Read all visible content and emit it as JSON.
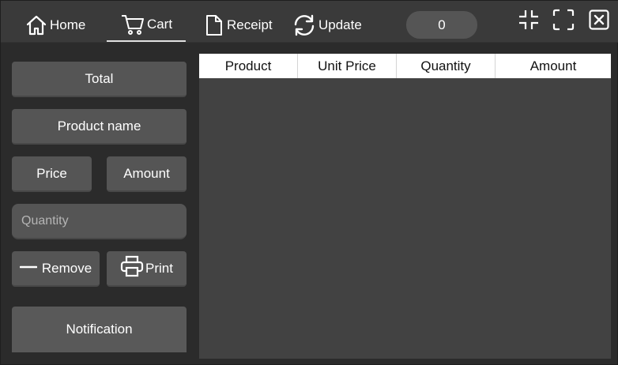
{
  "nav": {
    "home": {
      "label": "Home",
      "icon": "home-icon"
    },
    "cart": {
      "label": "Cart",
      "icon": "cart-icon"
    },
    "receipt": {
      "label": "Receipt",
      "icon": "document-icon"
    },
    "update": {
      "label": "Update",
      "icon": "refresh-icon"
    }
  },
  "cart_count": "0",
  "window_controls": {
    "minimize_icon": "collapse-icon",
    "maximize_icon": "fullscreen-icon",
    "close_icon": "close-icon"
  },
  "left_panel": {
    "total_label": "Total",
    "product_name_label": "Product name",
    "price_label": "Price",
    "amount_label": "Amount",
    "quantity_placeholder": "Quantity",
    "quantity_value": "",
    "remove_label": "Remove",
    "print_label": "Print",
    "notification_label": "Notification"
  },
  "table": {
    "columns": [
      "Product",
      "Unit Price",
      "Quantity",
      "Amount"
    ],
    "rows": []
  },
  "colors": {
    "background": "#2b2b2b",
    "topbar": "#3a3a3a",
    "panel_button": "#555555",
    "table_body": "#424242",
    "header_bg": "#ffffff"
  }
}
